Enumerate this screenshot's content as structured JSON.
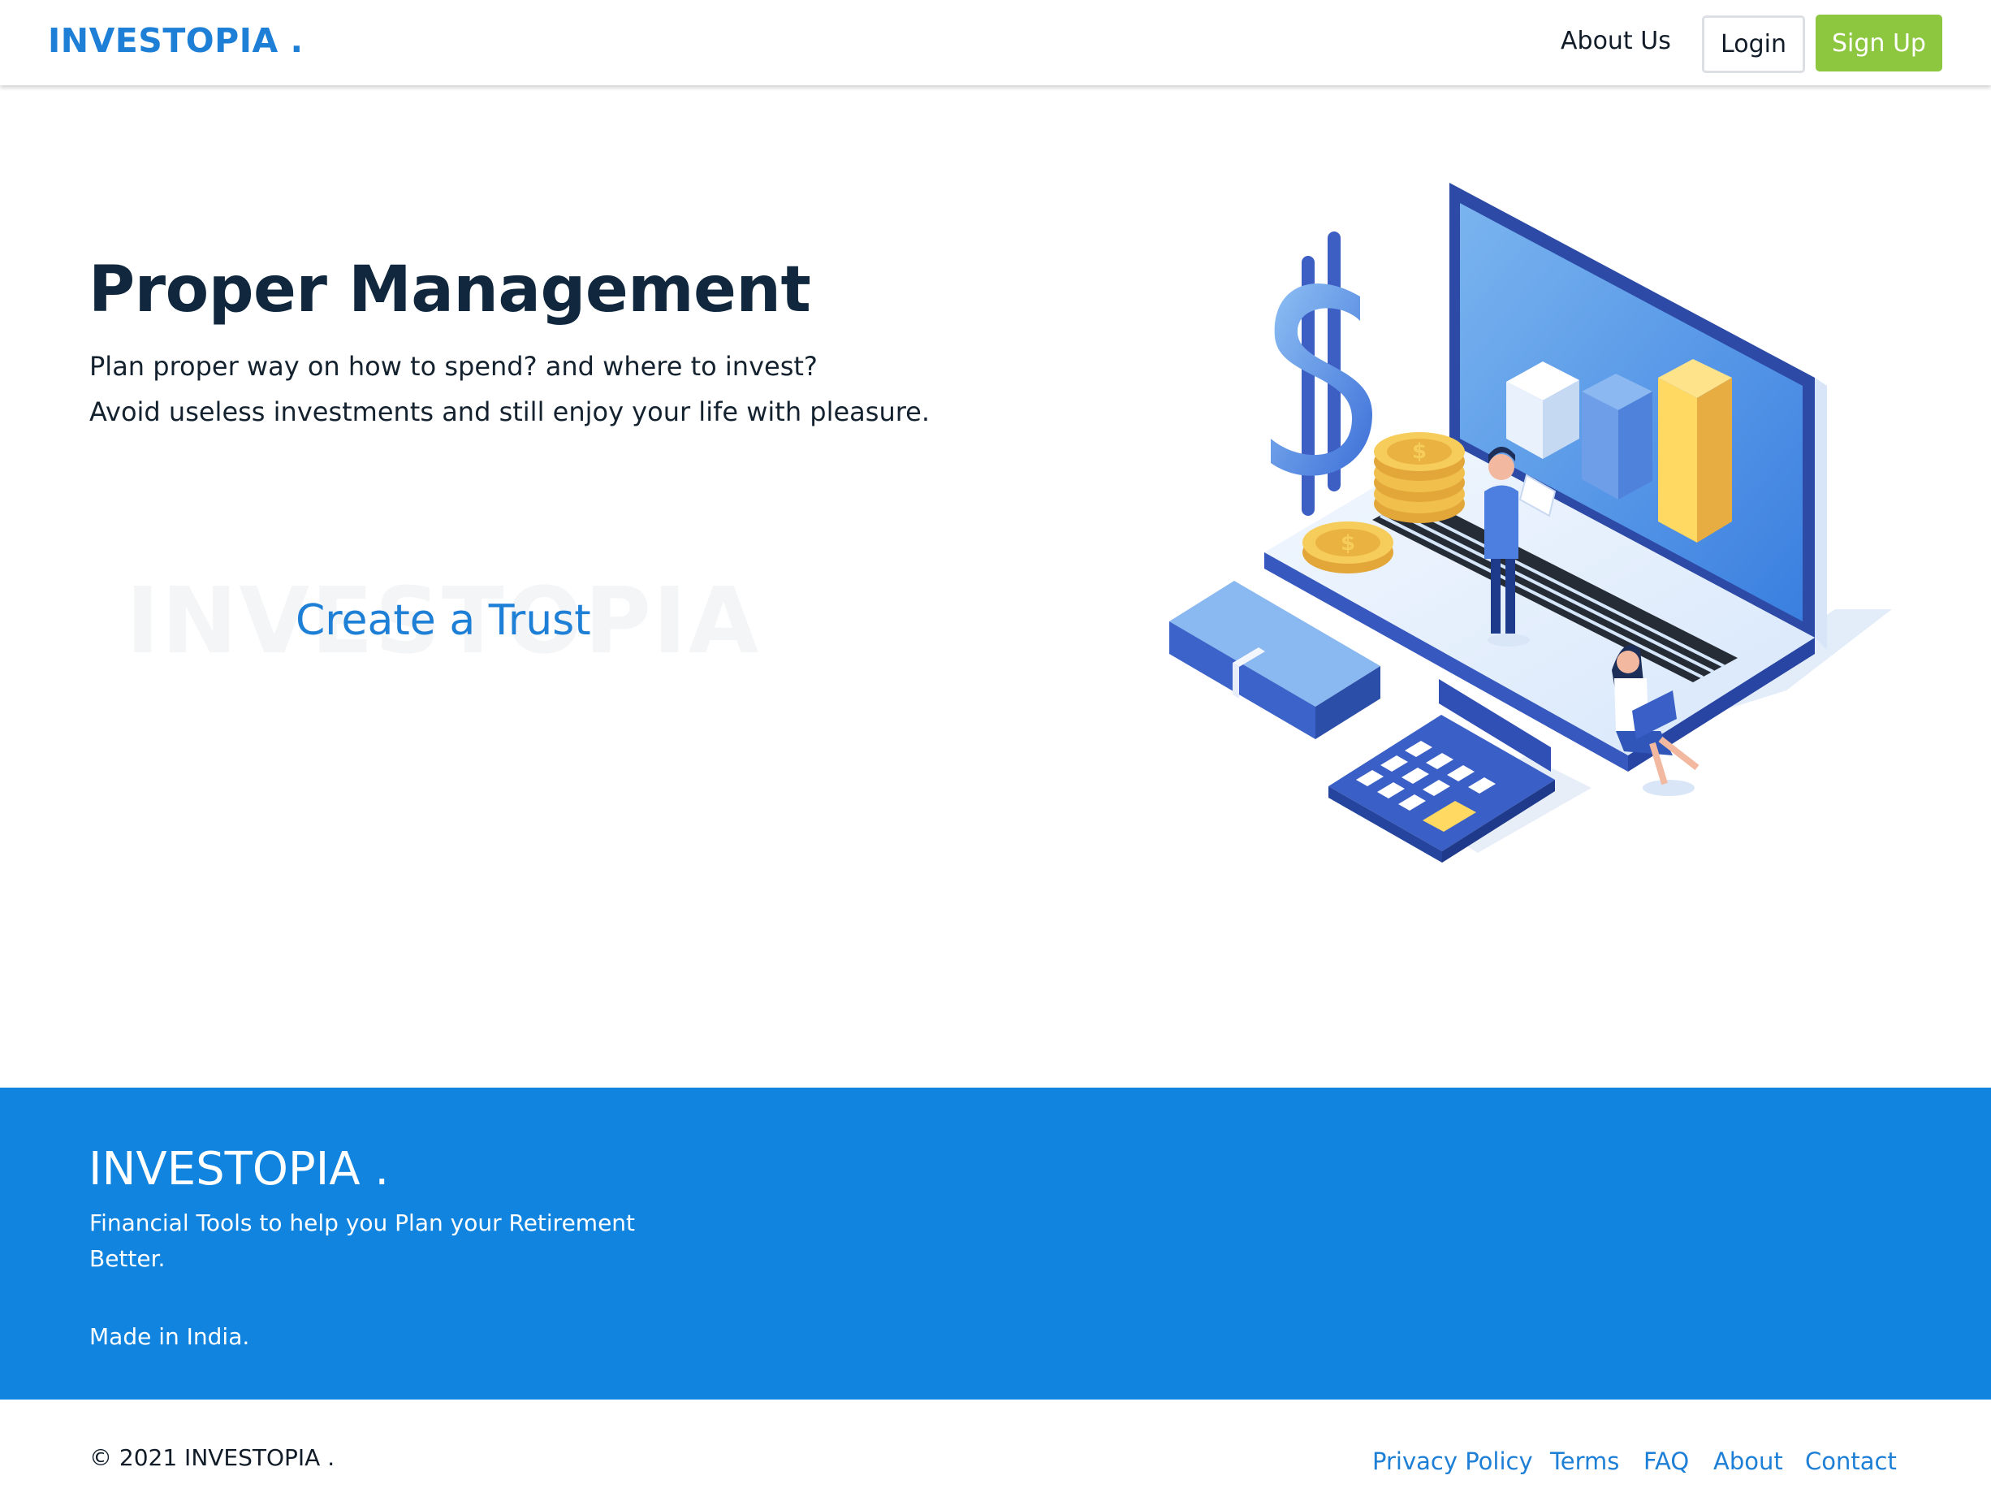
{
  "navbar": {
    "brand": "INVESTOPIA .",
    "about_label": "About Us",
    "login_label": "Login",
    "signup_label": "Sign Up"
  },
  "hero": {
    "title": "Proper Management",
    "line1": "Plan proper way on how to spend? and where to invest?",
    "line2": "Avoid useless investments and still enjoy your life with pleasure.",
    "watermark": "INVESTOPIA",
    "cta_label": "Create a Trust",
    "illustration_icon": "finance-laptop-illustration"
  },
  "footer": {
    "brand": "INVESTOPIA .",
    "tagline": "Financial Tools to help you Plan your Retirement Better.",
    "made_in": "Made in India."
  },
  "bottom": {
    "copyright": "© 2021 INVESTOPIA .",
    "links": [
      "Privacy Policy",
      "Terms",
      "FAQ",
      "About",
      "Contact"
    ]
  },
  "colors": {
    "brand_blue": "#1e7fd6",
    "footer_blue": "#1084df",
    "signup_green": "#8dc63f",
    "heading_dark": "#10273d"
  }
}
